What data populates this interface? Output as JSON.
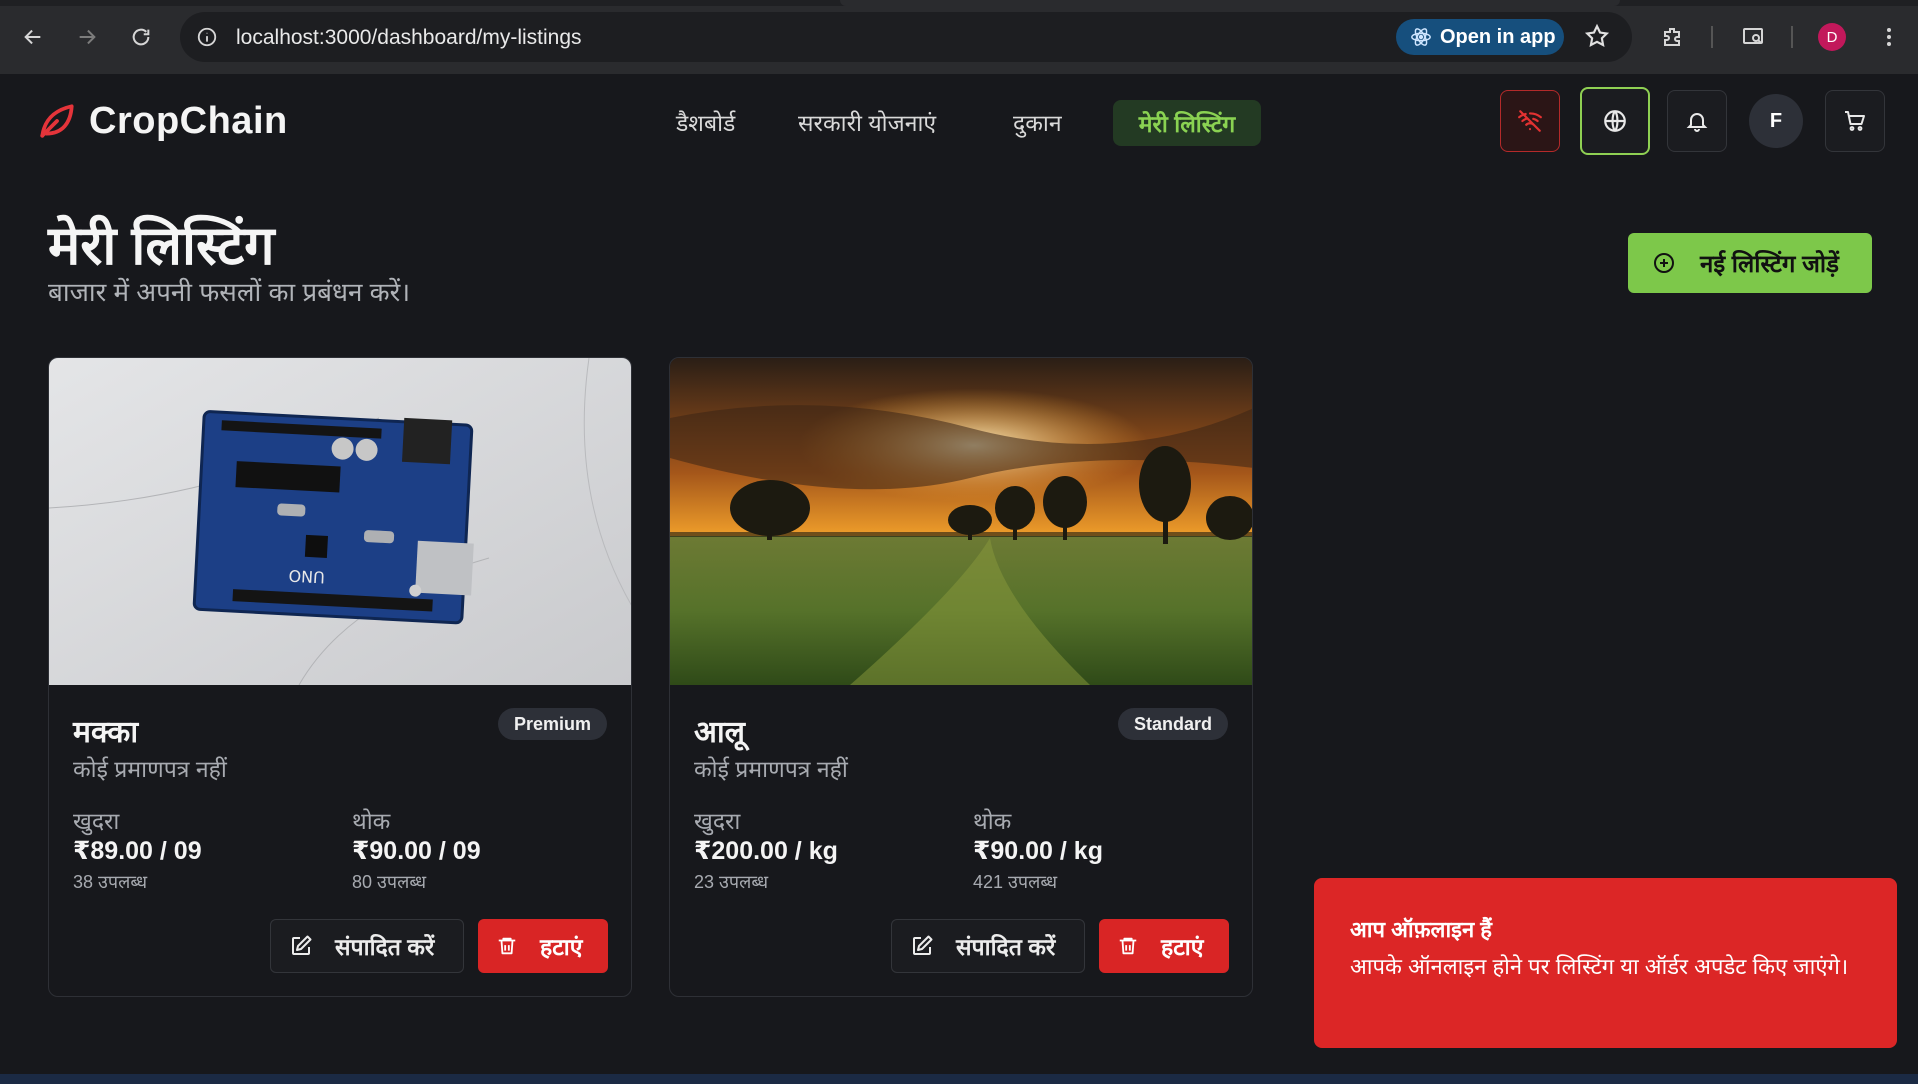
{
  "browser": {
    "url": "localhost:3000/dashboard/my-listings",
    "open_in_app_label": "Open in app",
    "profile_initial": "D"
  },
  "header": {
    "logo_text": "CropChain",
    "nav": {
      "dashboard": "डैशबोर्ड",
      "schemes": "सरकारी योजनाएं",
      "shop": "दुकान",
      "my_listings": "मेरी लिस्टिंग"
    },
    "avatar_initial": "F"
  },
  "page": {
    "title": "मेरी लिस्टिंग",
    "subtitle": "बाजार में अपनी फसलों का प्रबंधन करें।",
    "add_button": "नई लिस्टिंग जोड़ें"
  },
  "listings": [
    {
      "name": "मक्का",
      "badge": "Premium",
      "cert": "कोई प्रमाणपत्र नहीं",
      "retail_label": "खुदरा",
      "retail_price": "₹89.00 / 09",
      "retail_avail": "38 उपलब्ध",
      "wholesale_label": "थोक",
      "wholesale_price": "₹90.00 / 09",
      "wholesale_avail": "80 उपलब्ध",
      "edit_label": "संपादित करें",
      "delete_label": "हटाएं"
    },
    {
      "name": "आलू",
      "badge": "Standard",
      "cert": "कोई प्रमाणपत्र नहीं",
      "retail_label": "खुदरा",
      "retail_price": "₹200.00 / kg",
      "retail_avail": "23 उपलब्ध",
      "wholesale_label": "थोक",
      "wholesale_price": "₹90.00 / kg",
      "wholesale_avail": "421 उपलब्ध",
      "edit_label": "संपादित करें",
      "delete_label": "हटाएं"
    }
  ],
  "toast": {
    "title": "आप ऑफ़लाइन हैं",
    "body": "आपके ऑनलाइन होने पर लिस्टिंग या ऑर्डर अपडेट किए जाएंगे।"
  },
  "colors": {
    "accent_green": "#7dc84a",
    "danger_red": "#d92525",
    "background": "#17181c"
  }
}
